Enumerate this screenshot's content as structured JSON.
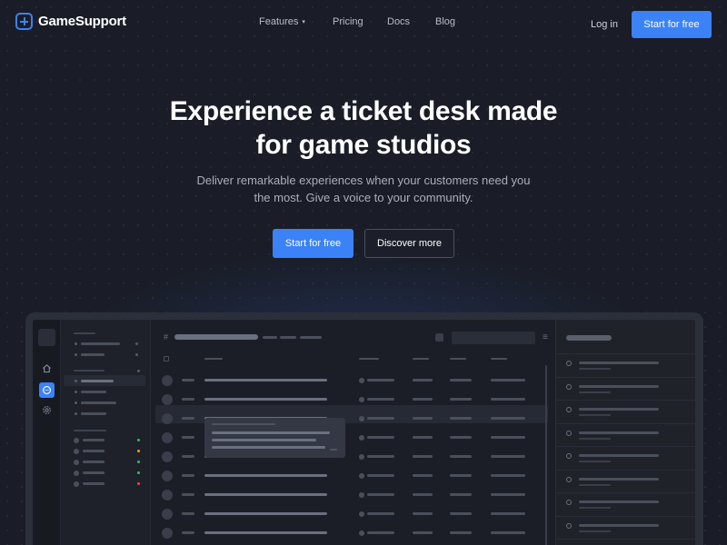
{
  "brand": {
    "name": "GameSupport",
    "accent_color": "#3b82f6",
    "logo_icon": "plus-in-rounded-square"
  },
  "nav": {
    "links": [
      {
        "label": "Features",
        "has_dropdown": true
      },
      {
        "label": "Pricing"
      },
      {
        "label": "Docs"
      },
      {
        "label": "Blog"
      }
    ],
    "dropdown_caret": "▾",
    "login_label": "Log in",
    "cta_label": "Start for free"
  },
  "hero": {
    "title_line1": "Experience a ticket desk made",
    "title_line2": "for game studios",
    "subtitle_line1": "Deliver remarkable experiences when your customers need you",
    "subtitle_line2": "the most. Give a voice to your community.",
    "primary_cta": "Start for free",
    "secondary_cta": "Discover more"
  },
  "preview": {
    "rail_icons": [
      "home-icon",
      "chat-icon",
      "settings-icon"
    ],
    "status_colors": [
      "#22c55e",
      "#f59e0b",
      "#22c55e",
      "#22c55e",
      "#ef4444"
    ],
    "hash_symbol": "#",
    "menu_symbol": "≡"
  }
}
